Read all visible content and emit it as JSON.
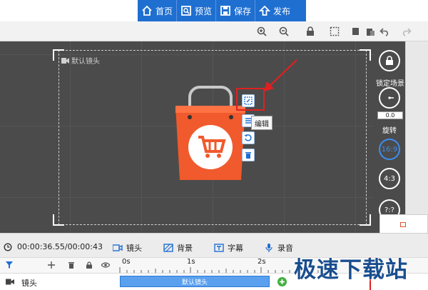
{
  "menu": {
    "home": "首页",
    "preview": "预览",
    "save": "保存",
    "publish": "发布"
  },
  "canvas": {
    "camera_label": "默认镜头",
    "tooltip": "编辑"
  },
  "right_panel": {
    "lock_label": "锁定场景",
    "rotate_value": "0.0",
    "rotate_label": "旋转",
    "ratio_16_9": "16:9",
    "ratio_4_3": "4:3",
    "ratio_custom": "?:?"
  },
  "timeline": {
    "time": "00:00:36.55/00:00:43",
    "tabs": [
      "镜头",
      "背景",
      "字幕",
      "录音"
    ],
    "ruler": [
      "0s",
      "1s",
      "2s"
    ],
    "track_label": "镜头",
    "clip_label": "默认镜头"
  },
  "watermark": "极速下载站",
  "colors": {
    "accent": "#1f6fd1",
    "bag": "#f05a2c",
    "highlight": "#e02020"
  }
}
